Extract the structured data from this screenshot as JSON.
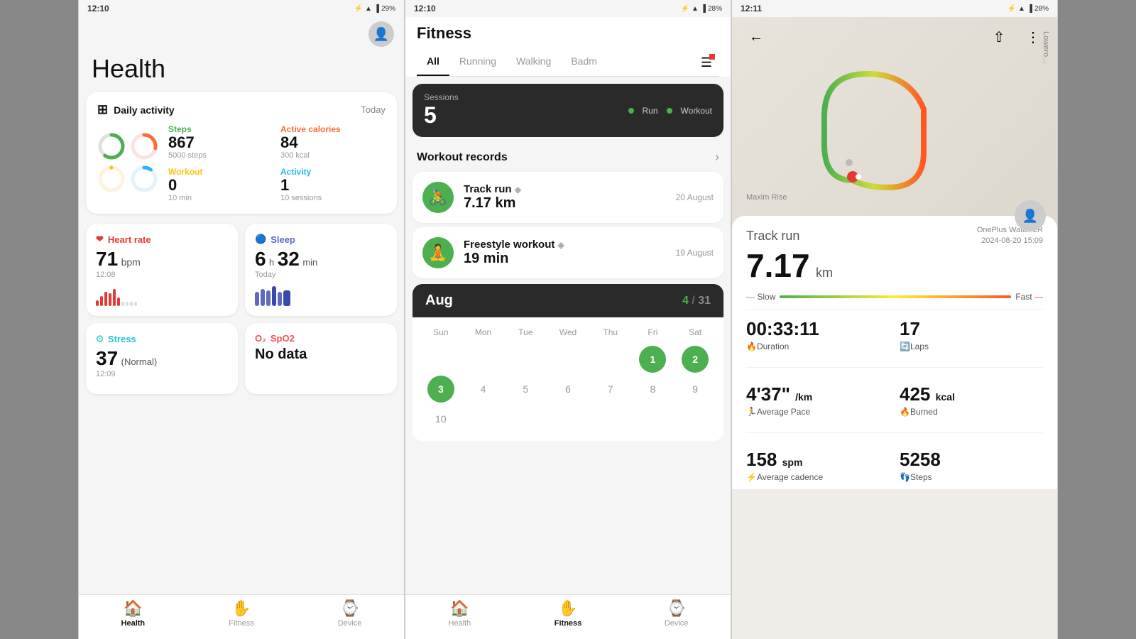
{
  "phone1": {
    "status": {
      "time": "12:10",
      "battery": "29%"
    },
    "title": "Health",
    "daily_activity": {
      "label": "Daily activity",
      "period": "Today",
      "steps": {
        "label": "Steps",
        "value": "867",
        "sub": "5000 steps"
      },
      "calories": {
        "label": "Active calories",
        "value": "84",
        "sub": "300 kcal"
      },
      "workout": {
        "label": "Workout",
        "value": "0",
        "sub": "10 min"
      },
      "activity": {
        "label": "Activity",
        "value": "1",
        "sub": "10 sessions"
      }
    },
    "heart_rate": {
      "label": "Heart rate",
      "value": "71",
      "unit": "bpm",
      "time": "12:08"
    },
    "sleep": {
      "label": "Sleep",
      "hours": "6",
      "minutes": "32",
      "period": "Today"
    },
    "stress": {
      "label": "Stress",
      "value": "37",
      "status": "(Normal)",
      "time": "12:09"
    },
    "spo2": {
      "label": "SpO2",
      "value": "No data"
    },
    "nav": {
      "health": "Health",
      "fitness": "Fitness",
      "device": "Device"
    }
  },
  "phone2": {
    "status": {
      "time": "12:10",
      "battery": "28%"
    },
    "title": "Fitness",
    "tabs": [
      "All",
      "Running",
      "Walking",
      "Badm"
    ],
    "sessions": {
      "label": "Sessions",
      "value": "5",
      "legend_run": "Run",
      "legend_workout": "Workout"
    },
    "workout_records_title": "Workout records",
    "workouts": [
      {
        "name": "Track run",
        "distance": "7.17 km",
        "date": "20 August",
        "icon": "🚴"
      },
      {
        "name": "Freestyle workout",
        "duration": "19 min",
        "date": "19 August",
        "icon": "🧘"
      }
    ],
    "calendar": {
      "month": "Aug",
      "progress": "4",
      "total": "31",
      "days_header": [
        "Sun",
        "Mon",
        "Tue",
        "Wed",
        "Thu",
        "Fri",
        "Sat"
      ],
      "workout_days": [
        1,
        2,
        3
      ],
      "visible_days_row1": [
        "",
        "",
        "",
        "",
        "",
        "1",
        "2",
        "3"
      ],
      "visible_days_row2": [
        "4",
        "5",
        "6",
        "7",
        "8",
        "9",
        "10"
      ]
    },
    "nav": {
      "health": "Health",
      "fitness": "Fitness",
      "device": "Device"
    }
  },
  "phone3": {
    "status": {
      "time": "12:11",
      "battery": "28%"
    },
    "title": "Track run",
    "distance": "7.17",
    "unit": "km",
    "device": "OnePlus Watch 2R",
    "date": "2024-08-20 15:09",
    "pace_slow": "Slow",
    "pace_fast": "Fast",
    "stats": {
      "duration": {
        "value": "00:33:11",
        "label": "Duration"
      },
      "laps": {
        "value": "17",
        "label": "Laps"
      },
      "avg_pace": {
        "value": "4'37\"",
        "label": "Average Pace",
        "unit": "/km"
      },
      "burned": {
        "value": "425",
        "label": "Burned",
        "unit": "kcal"
      },
      "cadence": {
        "value": "158",
        "label": "Average cadence",
        "unit": "spm"
      },
      "steps": {
        "value": "5258",
        "label": "Steps"
      }
    }
  }
}
